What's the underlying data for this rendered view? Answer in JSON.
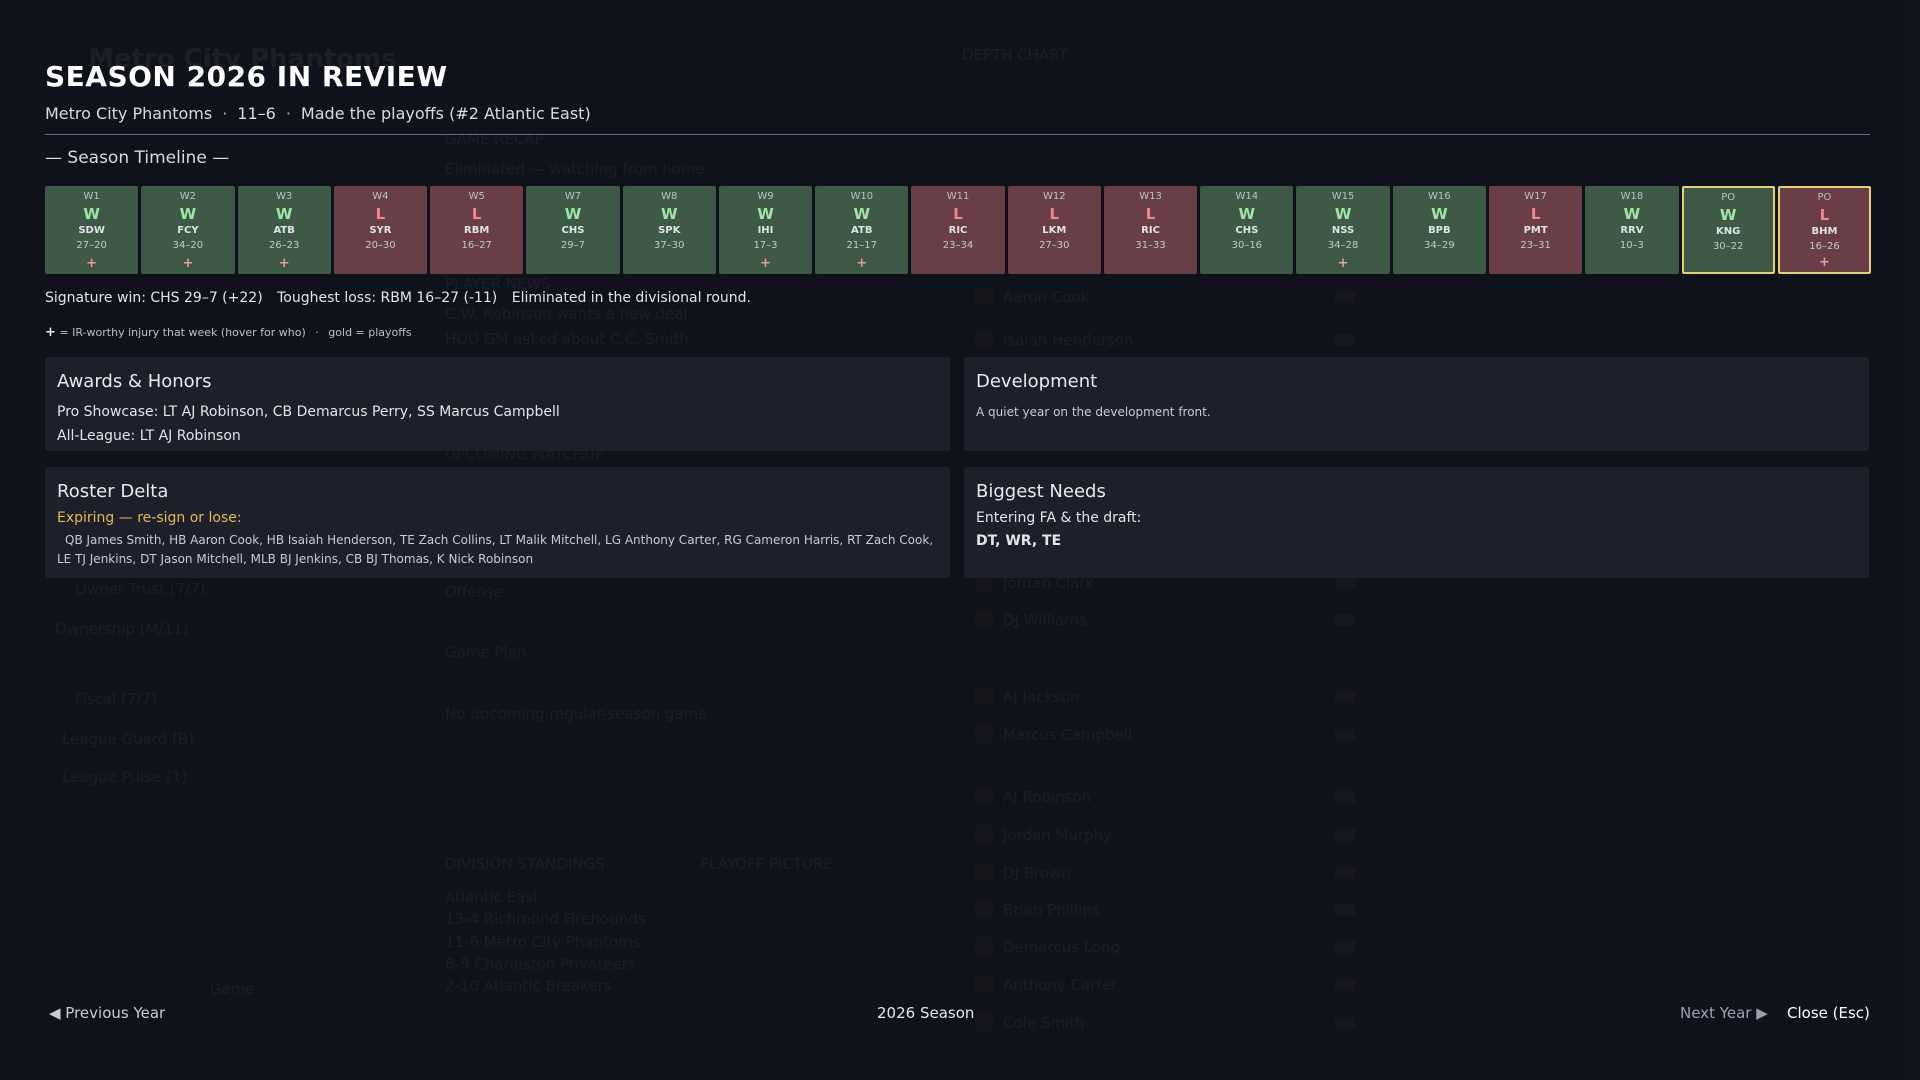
{
  "header": {
    "title": "SEASON 2026 IN REVIEW",
    "team": "Metro City Phantoms",
    "record": "11–6",
    "result": "Made the playoffs (#2 Atlantic East)",
    "separator": "·"
  },
  "timeline": {
    "heading": "— Season Timeline —",
    "games": [
      {
        "week": "W1",
        "result": "W",
        "opp": "SDW",
        "score": "27–20",
        "injury": true,
        "playoff": false
      },
      {
        "week": "W2",
        "result": "W",
        "opp": "FCY",
        "score": "34–20",
        "injury": true,
        "playoff": false
      },
      {
        "week": "W3",
        "result": "W",
        "opp": "ATB",
        "score": "26–23",
        "injury": true,
        "playoff": false
      },
      {
        "week": "W4",
        "result": "L",
        "opp": "SYR",
        "score": "20–30",
        "injury": false,
        "playoff": false
      },
      {
        "week": "W5",
        "result": "L",
        "opp": "RBM",
        "score": "16–27",
        "injury": false,
        "playoff": false
      },
      {
        "week": "W7",
        "result": "W",
        "opp": "CHS",
        "score": "29–7",
        "injury": false,
        "playoff": false
      },
      {
        "week": "W8",
        "result": "W",
        "opp": "SPK",
        "score": "37–30",
        "injury": false,
        "playoff": false
      },
      {
        "week": "W9",
        "result": "W",
        "opp": "IHI",
        "score": "17–3",
        "injury": true,
        "playoff": false
      },
      {
        "week": "W10",
        "result": "W",
        "opp": "ATB",
        "score": "21–17",
        "injury": true,
        "playoff": false
      },
      {
        "week": "W11",
        "result": "L",
        "opp": "RIC",
        "score": "23–34",
        "injury": false,
        "playoff": false
      },
      {
        "week": "W12",
        "result": "L",
        "opp": "LKM",
        "score": "27–30",
        "injury": false,
        "playoff": false
      },
      {
        "week": "W13",
        "result": "L",
        "opp": "RIC",
        "score": "31–33",
        "injury": false,
        "playoff": false
      },
      {
        "week": "W14",
        "result": "W",
        "opp": "CHS",
        "score": "30–16",
        "injury": false,
        "playoff": false
      },
      {
        "week": "W15",
        "result": "W",
        "opp": "NSS",
        "score": "34–28",
        "injury": true,
        "playoff": false
      },
      {
        "week": "W16",
        "result": "W",
        "opp": "BPB",
        "score": "34–29",
        "injury": false,
        "playoff": false
      },
      {
        "week": "W17",
        "result": "L",
        "opp": "PMT",
        "score": "23–31",
        "injury": false,
        "playoff": false
      },
      {
        "week": "W18",
        "result": "W",
        "opp": "RRV",
        "score": "10–3",
        "injury": false,
        "playoff": false
      },
      {
        "week": "PO",
        "result": "W",
        "opp": "KNG",
        "score": "30–22",
        "injury": false,
        "playoff": true
      },
      {
        "week": "PO",
        "result": "L",
        "opp": "BHM",
        "score": "16–26",
        "injury": true,
        "playoff": true
      }
    ],
    "injury_symbol": "+"
  },
  "summary": {
    "signature": "Signature win: CHS 29–7 (+22)",
    "toughest": "Toughest loss: RBM 16–27 (-11)",
    "eliminated": "Eliminated in the divisional round.",
    "legend_plus": "+",
    "legend_text": "= IR-worthy injury that week (hover for who)",
    "legend_sep": "·",
    "legend_gold": "gold = playoffs"
  },
  "awards": {
    "title": "Awards & Honors",
    "pro_showcase": "Pro Showcase: LT AJ Robinson, CB Demarcus Perry, SS Marcus Campbell",
    "all_league": "All-League: LT AJ Robinson"
  },
  "development": {
    "title": "Development",
    "text": "A quiet year on the development front."
  },
  "roster": {
    "title": "Roster Delta",
    "expiring_label": "Expiring — re-sign or lose:",
    "expiring_list": "QB James Smith, HB Aaron Cook, HB Isaiah Henderson, TE Zach Collins, LT Malik Mitchell, LG Anthony Carter, RG Cameron Harris, RT Zach Cook, LE TJ Jenkins, DT Jason Mitchell, MLB BJ Jenkins, CB BJ Thomas, K Nick Robinson"
  },
  "needs": {
    "title": "Biggest Needs",
    "label": "Entering FA & the draft:",
    "positions": "DT, WR, TE"
  },
  "footer": {
    "prev": "◀ Previous Year",
    "season": "2026 Season",
    "next": "Next Year ▶",
    "close": "Close (Esc)"
  },
  "colors": {
    "win": "#3e5a46",
    "loss": "#6a3e46",
    "playoff_border": "#e4d26c",
    "expiring": "#e8b84a"
  }
}
